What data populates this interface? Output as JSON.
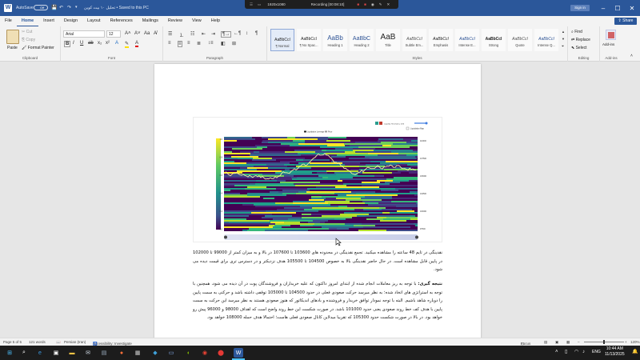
{
  "titlebar": {
    "autosave_label": "AutoSave",
    "autosave_state": "Off",
    "doc_title": "تحلیل ۱۰ بیت کوین • Saved to this PC",
    "sign_in": "Sign in"
  },
  "recorder": {
    "resolution": "1920x1080",
    "status": "Recording [00:08:10]"
  },
  "menu": {
    "tabs": [
      "File",
      "Home",
      "Insert",
      "Design",
      "Layout",
      "References",
      "Mailings",
      "Review",
      "View",
      "Help"
    ],
    "active": "Home",
    "share_label": "Share"
  },
  "ribbon": {
    "clipboard": {
      "paste": "Paste",
      "cut": "Cut",
      "copy": "Copy",
      "format_painter": "Format Painter",
      "label": "Clipboard"
    },
    "font": {
      "name": "Arial",
      "size": "12",
      "label": "Font"
    },
    "paragraph": {
      "label": "Paragraph"
    },
    "styles": {
      "items": [
        {
          "preview": "AaBbCcI",
          "name": "¶ Normal"
        },
        {
          "preview": "AaBbCcI",
          "name": "¶ No Spac..."
        },
        {
          "preview": "AaBb",
          "name": "Heading 1"
        },
        {
          "preview": "AaBbC",
          "name": "Heading 2"
        },
        {
          "preview": "AaB",
          "name": "Title"
        },
        {
          "preview": "AaBbCcI",
          "name": "Subtle Em..."
        },
        {
          "preview": "AaBbCcI",
          "name": "Emphasis"
        },
        {
          "preview": "AaBbCcI",
          "name": "Intense E..."
        },
        {
          "preview": "AaBbCcI",
          "name": "Strong"
        },
        {
          "preview": "AaBbCcI",
          "name": "Quote"
        },
        {
          "preview": "AaBbCcI",
          "name": "Intense Q..."
        }
      ],
      "label": "Styles"
    },
    "editing": {
      "find": "Find",
      "replace": "Replace",
      "select": "Select",
      "label": "Editing"
    },
    "addins": {
      "button": "Add-ins",
      "label": "Add-ins"
    }
  },
  "chart_data": {
    "type": "heatmap",
    "title": "",
    "legend": [
      "Liquidation Leverage",
      "Price"
    ],
    "controls": {
      "threshold_label": "Liquidity Threshold = 0.80",
      "toggle_label": "Liquidation Map"
    },
    "y_ticks": [
      "110000",
      "107500",
      "105000",
      "102500",
      "100000",
      "97500"
    ],
    "colorbar_ticks": [
      "1.0",
      "0.8",
      "0.6",
      "0.4",
      "0.2",
      "0.0"
    ]
  },
  "document": {
    "paragraph1": "نقدینگی در تایم 48 ساعته را مشاهده میکنید. تجمع نقدینگی در محدوده های 103600 تا 107600 در بالا و به میزان کمتر از 99000 تا 102000 در پایین قابل مشاهده است. در حال حاضر نقدینگی بالا به خصوص 104500 تا 105500 هدف نزدیکتر و در دسترس تری برای قیمت دیده می شود.",
    "conclusion_label": "نتیجه گیری:",
    "paragraph2": " با توجه به ریز معاملات انجام شده از ابتدای امروز داکتون که علیه خریداران و فروشندگان پوت در آن دیده می شود، همچنین با توجه به استراتژی های اتخاذ شده؛ به نظر میرسد حرکت صعودی فعلی در حدود 104500 تا 105000 توقفی داشته باشد و حرکتی به سمت پایین را دوباره شاهد باشیم. البته با توجه نمودار توافق خریدار و فروشنده و بادهای اندیکاتور که هنوز صعودی هستند به نظر میرسد این حرکت به سمت پایین با هدف کف خط روند صعودی یعنی حدود 101000 باشد. در صورت شکست این خط روند واضح است که اهداف 98000 و 96000 پیش رو خواهد بود. در بالا در صورت شکست حدود 105300 که تقریبا میدلاین کانال صعودی فعلی هاست؛ احتمالا هدف حمله 108000 خواهد بود."
  },
  "status": {
    "page": "Page 5 of 5",
    "words": "121 words",
    "language": "Persian (Iran)",
    "accessibility": "Accessibility: Investigate",
    "focus": "Focus",
    "zoom": "120%"
  },
  "taskbar": {
    "lang": "ENG",
    "time": "10:44 AM",
    "date": "11/13/2025"
  },
  "colors": {
    "word_blue": "#2b579a",
    "taskbar": "#1c1c1c"
  }
}
